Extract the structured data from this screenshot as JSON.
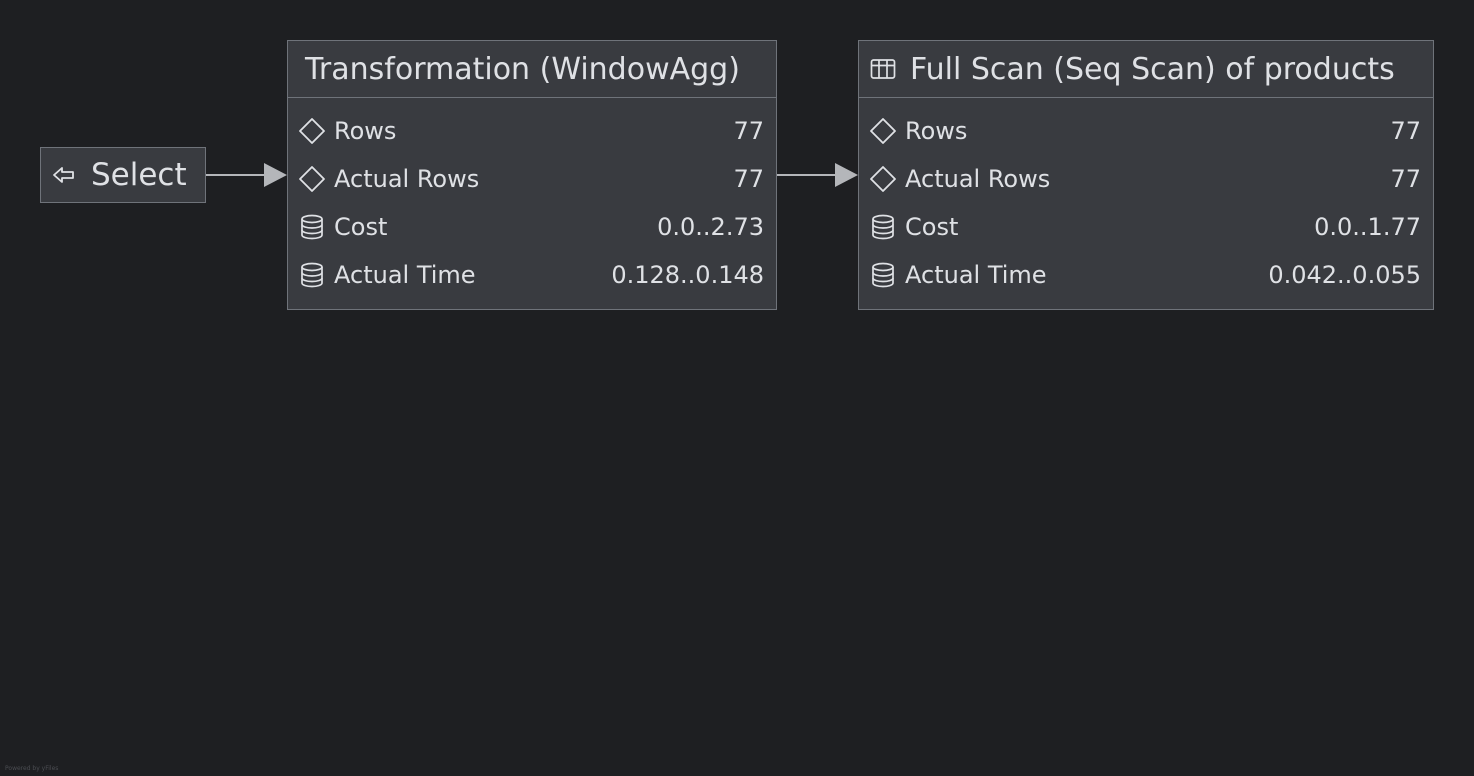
{
  "select_node": {
    "label": "Select",
    "icon": "select-arrow-icon"
  },
  "nodes": [
    {
      "id": "transform",
      "title": "Transformation (WindowAgg)",
      "title_icon": null,
      "rows": [
        {
          "icon": "diamond-icon",
          "label": "Rows",
          "value": "77"
        },
        {
          "icon": "diamond-icon",
          "label": "Actual Rows",
          "value": "77"
        },
        {
          "icon": "database-icon",
          "label": "Cost",
          "value": "0.0..2.73"
        },
        {
          "icon": "database-icon",
          "label": "Actual Time",
          "value": "0.128..0.148"
        }
      ]
    },
    {
      "id": "scan",
      "title": "Full Scan (Seq Scan) of products",
      "title_icon": "table-icon",
      "rows": [
        {
          "icon": "diamond-icon",
          "label": "Rows",
          "value": "77"
        },
        {
          "icon": "diamond-icon",
          "label": "Actual Rows",
          "value": "77"
        },
        {
          "icon": "database-icon",
          "label": "Cost",
          "value": "0.0..1.77"
        },
        {
          "icon": "database-icon",
          "label": "Actual Time",
          "value": "0.042..0.055"
        }
      ]
    }
  ],
  "edges": [
    {
      "from": "select",
      "to": "transform"
    },
    {
      "from": "transform",
      "to": "scan"
    }
  ],
  "colors": {
    "background": "#1e1f22",
    "node_fill": "#393b40",
    "node_border": "#6f737a",
    "text": "#dfe1e5",
    "edge": "#b4b6ba"
  },
  "footer": "Powered by yFiles"
}
